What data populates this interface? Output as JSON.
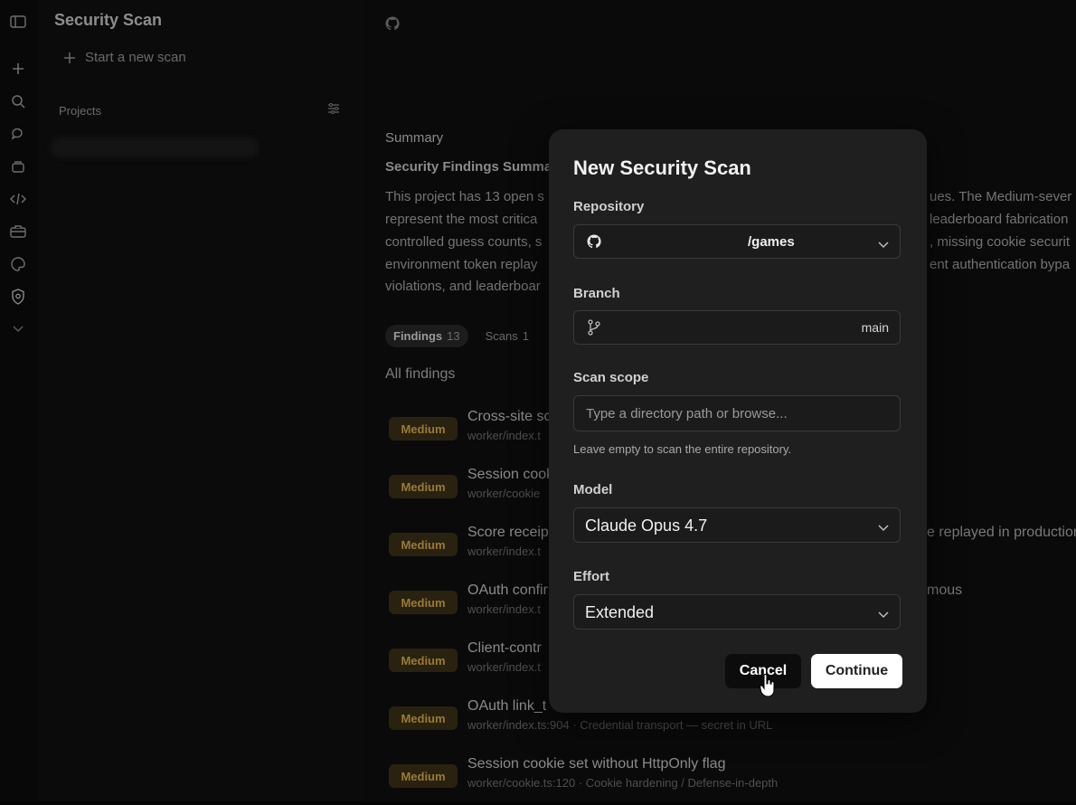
{
  "sidebar": {
    "title": "Security Scan",
    "new_scan_label": "Start a new scan",
    "projects_label": "Projects"
  },
  "main": {
    "summary_heading": "Summary",
    "findings_heading": "Security Findings Summa",
    "summary_lines_left": [
      "This project has 13 open s",
      "represent the most critica",
      "controlled guess counts, s",
      "environment token replay",
      "violations, and leaderboar"
    ],
    "summary_lines_right": [
      "ues. The Medium-sever",
      "leaderboard fabrication",
      ", missing cookie securit",
      "ent authentication bypa"
    ],
    "tabs": [
      {
        "label": "Findings",
        "count": "13"
      },
      {
        "label": "Scans",
        "count": "1"
      }
    ],
    "all_findings_label": "All findings",
    "findings": [
      {
        "severity": "Medium",
        "title": "Cross-site sc",
        "sub": "worker/index.t",
        "tail": ""
      },
      {
        "severity": "Medium",
        "title": "Session cook",
        "sub": "worker/cookie",
        "tail": ""
      },
      {
        "severity": "Medium",
        "title": "Score receip",
        "sub": "worker/index.t",
        "tail": "e replayed in production"
      },
      {
        "severity": "Medium",
        "title": "OAuth confir",
        "sub": "worker/index.t",
        "tail": "mous"
      },
      {
        "severity": "Medium",
        "title": "Client-contr",
        "sub": "worker/index.t",
        "tail": ""
      },
      {
        "severity": "Medium",
        "title": "OAuth link_t",
        "sub": "worker/index.ts:904 · Credential transport — secret in URL",
        "tail": ""
      },
      {
        "severity": "Medium",
        "title": "Session cookie set without HttpOnly flag",
        "sub": "worker/cookie.ts:120 · Cookie hardening / Defense-in-depth",
        "tail": ""
      }
    ]
  },
  "modal": {
    "title": "New Security Scan",
    "repository_label": "Repository",
    "repository_value": "/games",
    "branch_label": "Branch",
    "branch_value": "main",
    "scope_label": "Scan scope",
    "scope_placeholder": "Type a directory path or browse...",
    "scope_hint": "Leave empty to scan the entire repository.",
    "model_label": "Model",
    "model_value": "Claude Opus 4.7",
    "effort_label": "Effort",
    "effort_value": "Extended",
    "cancel_label": "Cancel",
    "continue_label": "Continue"
  },
  "colors": {
    "modal_bg": "#1f1f1f",
    "badge_bg": "#2a2210",
    "badge_text": "#9a7a36",
    "primary_button": "#ffffff",
    "cancel_button": "#0c0c0c"
  }
}
